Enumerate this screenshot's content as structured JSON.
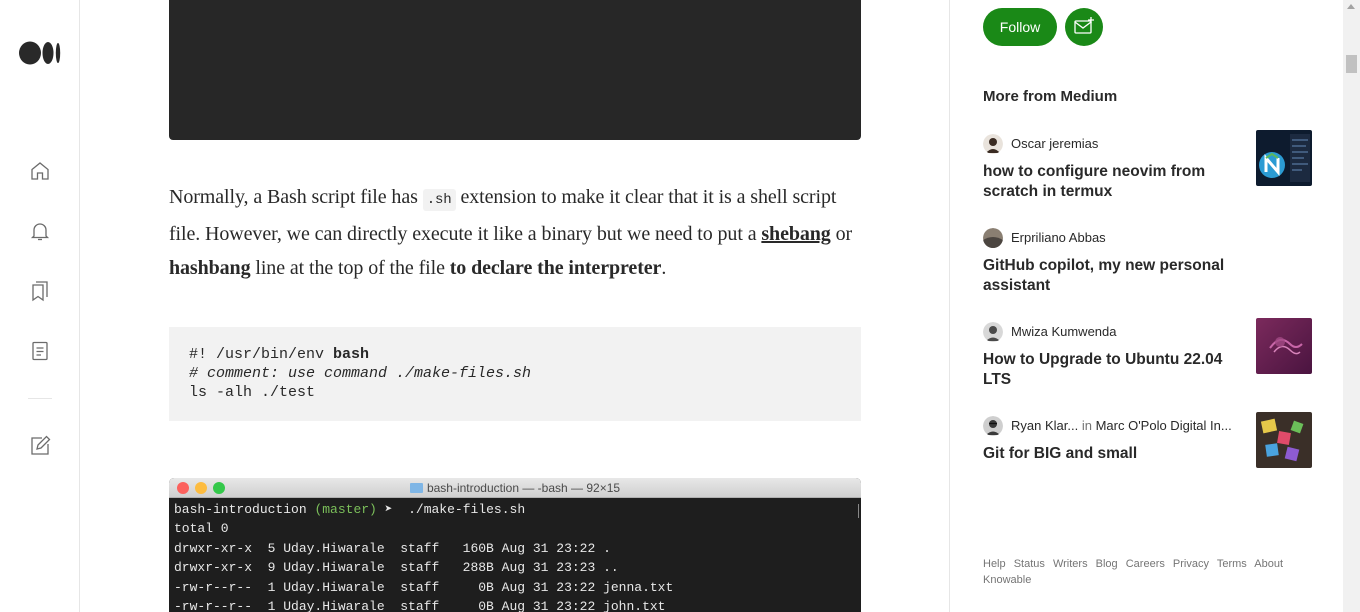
{
  "article": {
    "para_1": "Normally, a Bash script file has ",
    "para_code": ".sh",
    "para_2": " extension to make it clear that it is a shell script file. However, we can directly execute it like a binary but we need to put a ",
    "para_link": "shebang",
    "para_3": " or ",
    "para_bold_1": "hashbang",
    "para_4": " line at the top of the file ",
    "para_bold_2": "to declare the interpreter",
    "para_5": ".",
    "code_line_1_a": "#! /usr/bin/env ",
    "code_line_1_b": "bash",
    "code_line_2": "# comment: use command ./make-files.sh",
    "code_line_3": "ls -alh ./test",
    "terminal": {
      "title": "bash-introduction — -bash — 92×15",
      "prompt_dir": "bash-introduction",
      "prompt_branch": "(master)",
      "prompt_cmd": "➤  ./make-files.sh",
      "lines": [
        "total 0",
        "drwxr-xr-x  5 Uday.Hiwarale  staff   160B Aug 31 23:22 .",
        "drwxr-xr-x  9 Uday.Hiwarale  staff   288B Aug 31 23:23 ..",
        "-rw-r--r--  1 Uday.Hiwarale  staff     0B Aug 31 23:22 jenna.txt",
        "-rw-r--r--  1 Uday.Hiwarale  staff     0B Aug 31 23:22 john.txt"
      ]
    }
  },
  "sidebar": {
    "follow_label": "Follow",
    "more_title": "More from Medium",
    "recommendations": [
      {
        "author": "Oscar jeremias",
        "title": "how to configure neovim from scratch in termux"
      },
      {
        "author": "Erpriliano Abbas",
        "title": "GitHub copilot, my new personal assistant"
      },
      {
        "author": "Mwiza Kumwenda",
        "title": "How to Upgrade to Ubuntu 22.04 LTS"
      },
      {
        "author": "Ryan Klar...",
        "in": "in",
        "publication": "Marc O'Polo Digital In...",
        "title": "Git for BIG and small"
      }
    ],
    "footer_links": [
      "Help",
      "Status",
      "Writers",
      "Blog",
      "Careers",
      "Privacy",
      "Terms",
      "About",
      "Knowable"
    ]
  },
  "colors": {
    "follow_button": "#1a8917",
    "code_dark": "#272727",
    "code_light": "#f2f2f2"
  },
  "icons": [
    "medium-logo-icon",
    "home-icon",
    "bell-icon",
    "bookmarks-icon",
    "stories-icon",
    "write-icon",
    "subscribe-mail-icon"
  ]
}
